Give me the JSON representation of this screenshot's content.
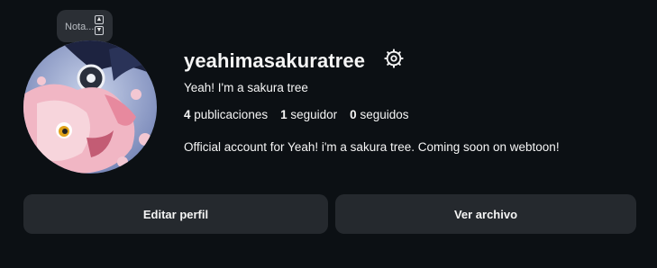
{
  "note": {
    "text": "Nota..."
  },
  "profile": {
    "username": "yeahimasakuratree",
    "full_name": "Yeah! I'm a sakura tree",
    "bio": "Official account for Yeah! i'm a sakura tree. Coming soon on webtoon!",
    "stats": {
      "posts_count": "4",
      "posts_label": "publicaciones",
      "followers_count": "1",
      "followers_label": "seguidor",
      "following_count": "0",
      "following_label": "seguidos"
    }
  },
  "actions": {
    "edit_profile": "Editar perfil",
    "view_archive": "Ver archivo"
  },
  "icons": {
    "settings": "gear-icon",
    "note_scroll_up": "chevron-up-icon",
    "note_scroll_down": "chevron-down-icon"
  },
  "colors": {
    "background": "#0c1014",
    "button": "#25292e",
    "note_bubble": "#2b2f35",
    "text": "#f5f5f5"
  }
}
